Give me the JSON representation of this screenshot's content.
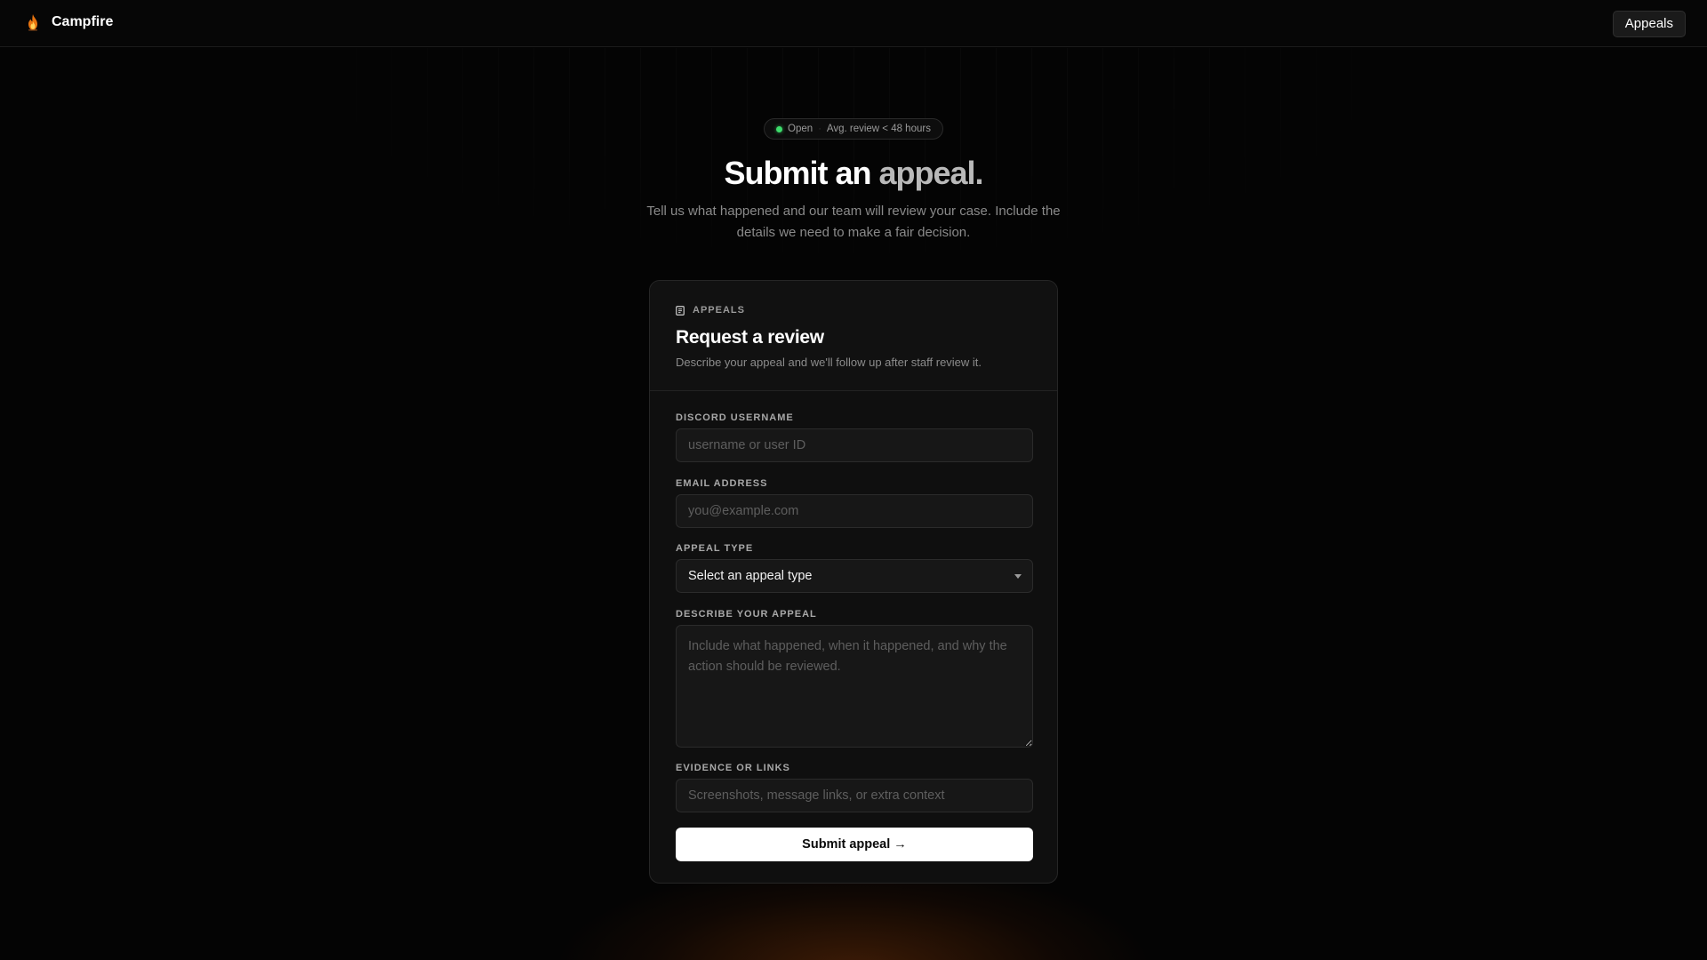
{
  "nav": {
    "brand_name": "Campfire",
    "appeals_label": "Appeals"
  },
  "status": {
    "state": "Open",
    "separator": "·",
    "review_time": "Avg. review < 48 hours",
    "dot_color": "#3ddc6b"
  },
  "hero": {
    "title_main": "Submit an",
    "title_accent": "appeal.",
    "subtitle": "Tell us what happened and our team will review your case. Include the details we need to make a fair decision."
  },
  "card": {
    "eyebrow": "APPEALS",
    "title": "Request a review",
    "description": "Describe your appeal and we'll follow up after staff review it."
  },
  "form": {
    "username": {
      "label": "DISCORD USERNAME",
      "placeholder": "username or user ID",
      "value": ""
    },
    "email": {
      "label": "EMAIL ADDRESS",
      "placeholder": "you@example.com",
      "value": ""
    },
    "appeal_type": {
      "label": "APPEAL TYPE",
      "selected": "Select an appeal type"
    },
    "description": {
      "label": "DESCRIBE YOUR APPEAL",
      "placeholder": "Include what happened, when it happened, and why the action should be reviewed.",
      "value": ""
    },
    "evidence": {
      "label": "EVIDENCE OR LINKS",
      "placeholder": "Screenshots, message links, or extra context",
      "value": ""
    },
    "submit_label": "Submit appeal →"
  },
  "icons": {
    "brand": "flame-icon",
    "eyebrow": "document-icon",
    "select": "chevron-down-icon"
  },
  "colors": {
    "background": "#040404",
    "accent_glow": "#be500a",
    "primary_button": "#ffffff"
  }
}
